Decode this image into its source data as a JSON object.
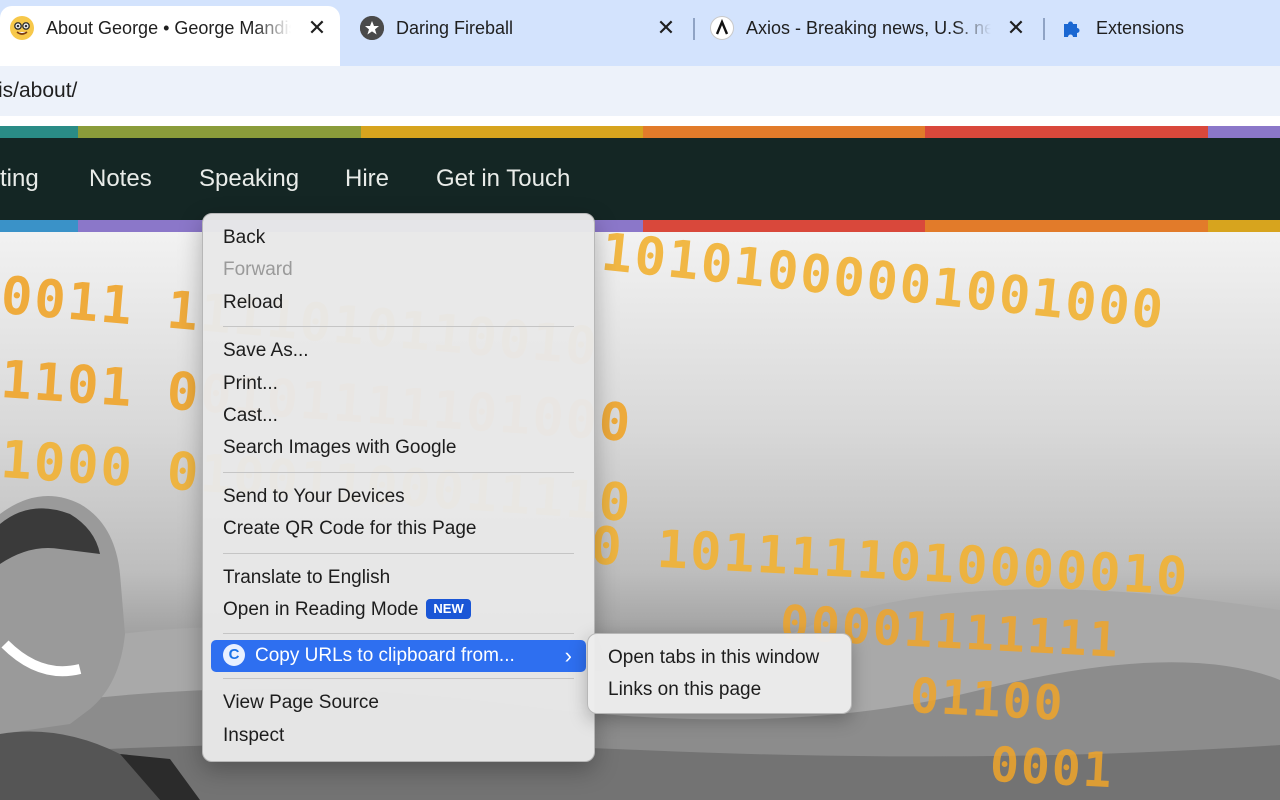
{
  "tabs": [
    {
      "title": "About George • George Mandis",
      "close": "✕",
      "active": true
    },
    {
      "title": "Daring Fireball",
      "close": "✕",
      "active": false
    },
    {
      "title": "Axios - Breaking news, U.S. news",
      "close": "✕",
      "active": false
    },
    {
      "title": "Extensions",
      "active": false
    }
  ],
  "omnibox": {
    "url_text": "is/about/"
  },
  "site": {
    "nav": [
      "ting",
      "Notes",
      "Speaking",
      "Hire",
      "Get in Touch"
    ],
    "stripe_colors": [
      "#2a8c86",
      "#8a9c3a",
      "#d7a41e",
      "#e27b2a",
      "#d9483b",
      "#8b77c9"
    ],
    "binary_rows": [
      "10101000001001000",
      "0011 1111010110010",
      "1101 00101111101000",
      "1000 01001100011110",
      "0 1011111010000010",
      "00001111111",
      "01100",
      "0001"
    ]
  },
  "context_menu": {
    "groups": [
      [
        {
          "label": "Back"
        },
        {
          "label": "Forward",
          "disabled": true
        },
        {
          "label": "Reload"
        }
      ],
      [
        {
          "label": "Save As..."
        },
        {
          "label": "Print..."
        },
        {
          "label": "Cast..."
        },
        {
          "label": "Search Images with Google"
        }
      ],
      [
        {
          "label": "Send to Your Devices"
        },
        {
          "label": "Create QR Code for this Page"
        }
      ],
      [
        {
          "label": "Translate to English"
        },
        {
          "label": "Open in Reading Mode",
          "badge": "NEW"
        }
      ],
      [
        {
          "label": "Copy URLs to clipboard from...",
          "highlighted": true,
          "chevron": "›"
        }
      ],
      [
        {
          "label": "View Page Source"
        },
        {
          "label": "Inspect"
        }
      ]
    ]
  },
  "submenu": {
    "items": [
      {
        "label": "Open tabs in this window"
      },
      {
        "label": "Links on this page"
      }
    ]
  }
}
